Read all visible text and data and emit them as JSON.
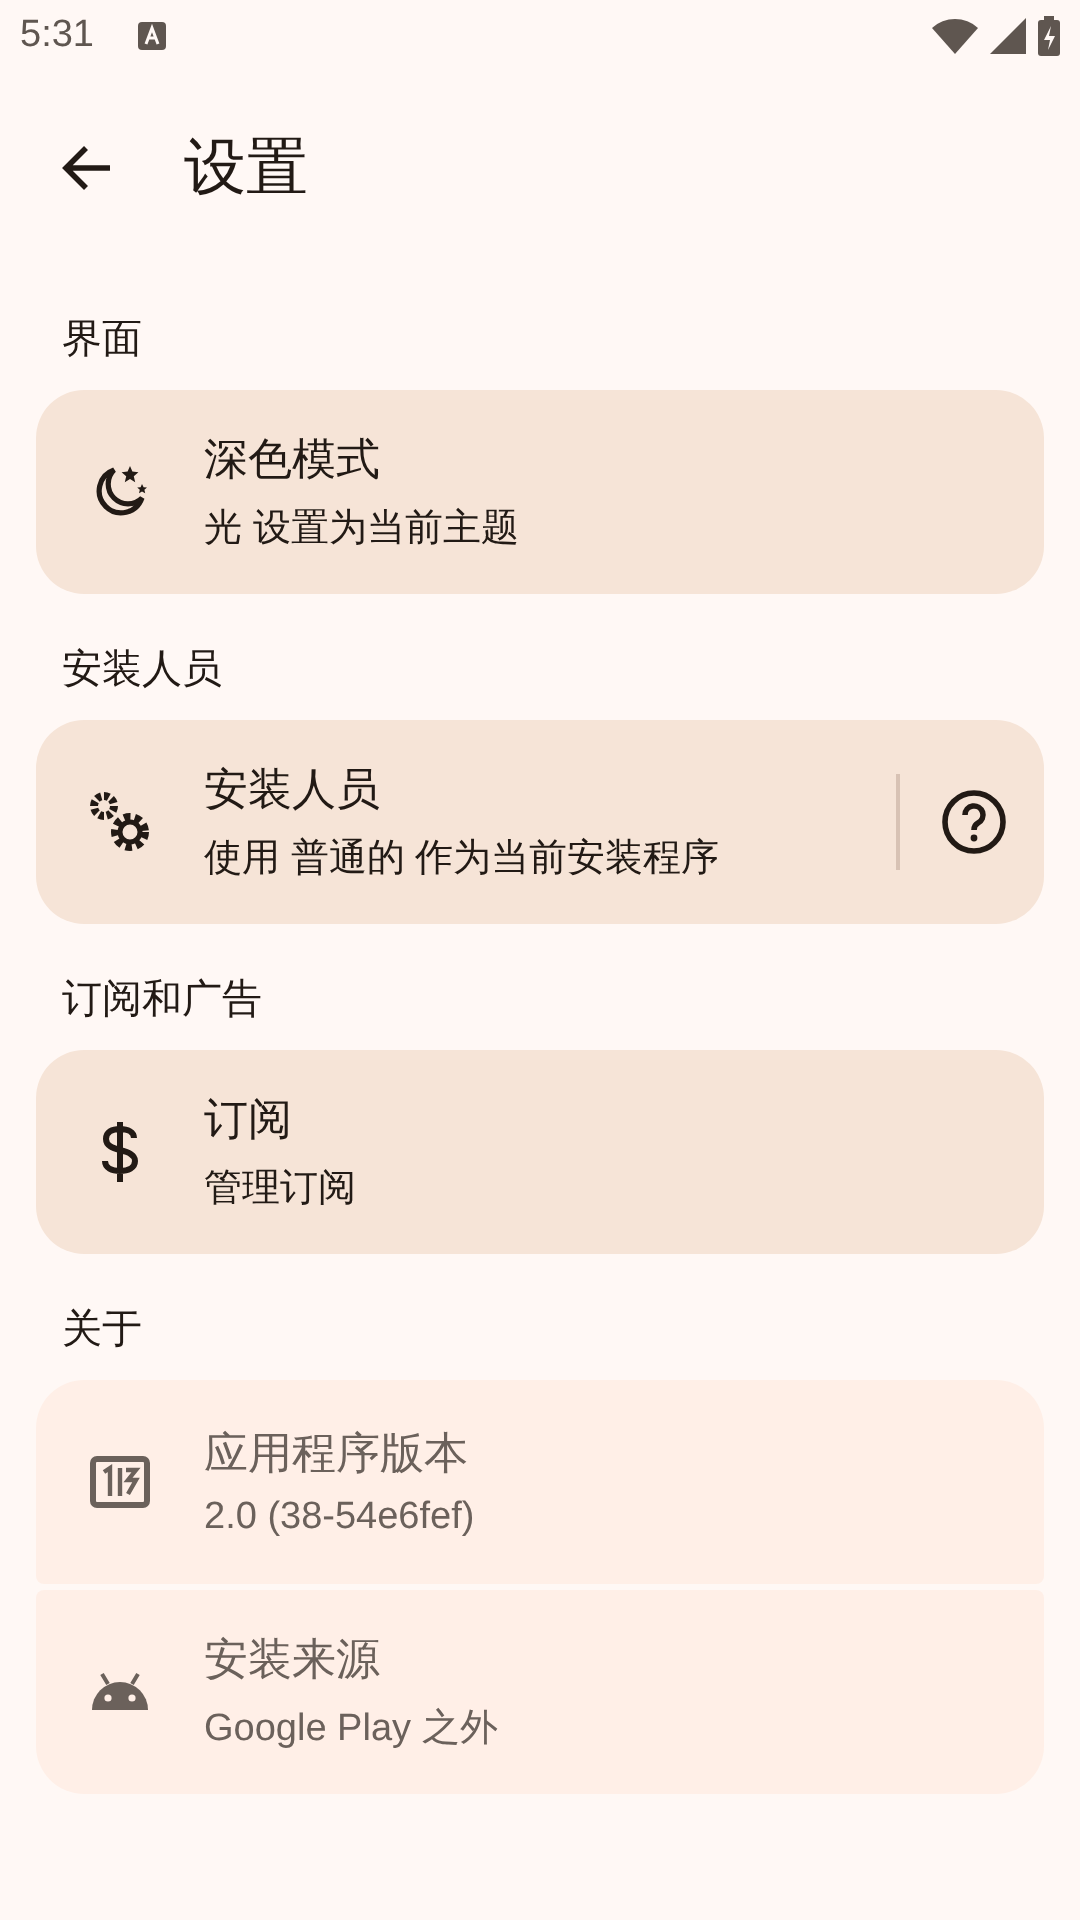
{
  "status_bar": {
    "time": "5:31"
  },
  "app_bar": {
    "title": "设置"
  },
  "sections": [
    {
      "title": "界面",
      "items": [
        {
          "title": "深色模式",
          "subtitle": "光 设置为当前主题",
          "disabled": false,
          "help": false
        }
      ]
    },
    {
      "title": "安装人员",
      "items": [
        {
          "title": "安装人员",
          "subtitle": "使用 普通的 作为当前安装程序",
          "disabled": false,
          "help": true
        }
      ]
    },
    {
      "title": "订阅和广告",
      "items": [
        {
          "title": "订阅",
          "subtitle": "管理订阅",
          "disabled": false,
          "help": false
        }
      ]
    },
    {
      "title": "关于",
      "items": [
        {
          "title": "应用程序版本",
          "subtitle": "2.0 (38-54e6fef)",
          "disabled": true,
          "help": false
        },
        {
          "title": "安装来源",
          "subtitle": "Google Play 之外",
          "disabled": true,
          "help": false
        }
      ]
    }
  ]
}
